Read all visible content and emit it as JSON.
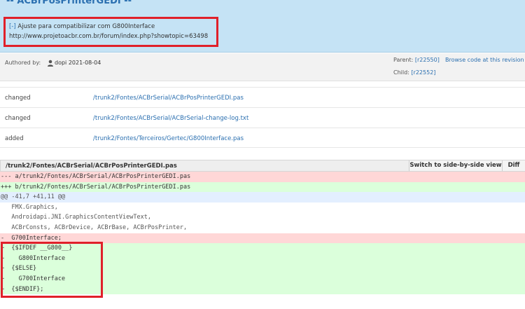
{
  "header": {
    "title": "-- ACBrPosPrinterGEDI --",
    "message_bracket": "[-]",
    "message_line1": "Ajuste para compatibilizar com G800Interface",
    "message_line2": "http://www.projetoacbr.com.br/forum/index.php?showtopic=63498"
  },
  "meta": {
    "authored_by_label": "Authored by:",
    "author": "dopi 2021-08-04",
    "parent_label": "Parent:",
    "parent_rev": "[r22550]",
    "child_label": "Child:",
    "child_rev": "[r22552]",
    "browse_label": "Browse code at this revision"
  },
  "files": [
    {
      "action": "changed",
      "path": "/trunk2/Fontes/ACBrSerial/ACBrPosPrinterGEDI.pas"
    },
    {
      "action": "changed",
      "path": "/trunk2/Fontes/ACBrSerial/ACBrSerial-change-log.txt"
    },
    {
      "action": "added",
      "path": "/trunk2/Fontes/Terceiros/Gertec/G800Interface.pas"
    }
  ],
  "diff": {
    "file_path": "/trunk2/Fontes/ACBrSerial/ACBrPosPrinterGEDI.pas",
    "switch_label": "Switch to side-by-side view",
    "diff_label": "Diff",
    "lines": [
      {
        "type": "del",
        "text": "--- a/trunk2/Fontes/ACBrSerial/ACBrPosPrinterGEDI.pas"
      },
      {
        "type": "add",
        "text": "+++ b/trunk2/Fontes/ACBrSerial/ACBrPosPrinterGEDI.pas"
      },
      {
        "type": "hunk",
        "text": "@@ -41,7 +41,11 @@"
      },
      {
        "type": "ctx",
        "text": "   FMX.Graphics,"
      },
      {
        "type": "ctx",
        "text": "   Androidapi.JNI.GraphicsContentViewText,"
      },
      {
        "type": "ctx",
        "text": "   ACBrConsts, ACBrDevice, ACBrBase, ACBrPosPrinter,"
      },
      {
        "type": "del",
        "text": "-  G700Interface;"
      },
      {
        "type": "add",
        "text": "+  {$IFDEF __G800__}"
      },
      {
        "type": "add",
        "text": "+    G800Interface"
      },
      {
        "type": "add",
        "text": "+  {$ELSE}"
      },
      {
        "type": "add",
        "text": "+    G700Interface"
      },
      {
        "type": "add",
        "text": "+  {$ENDIF};"
      }
    ]
  }
}
